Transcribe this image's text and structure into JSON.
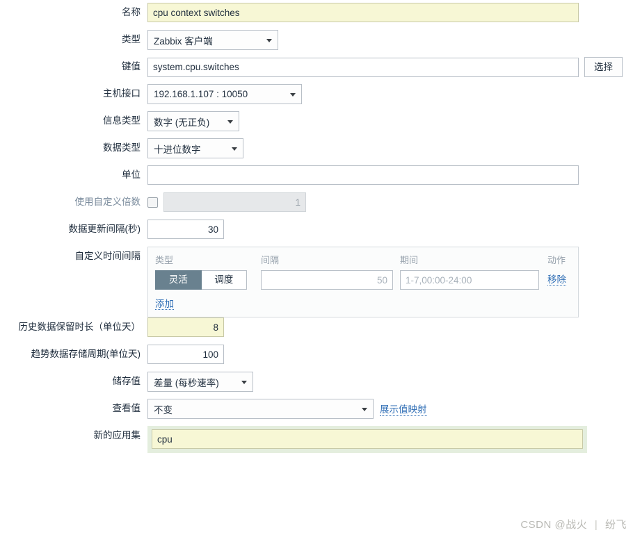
{
  "form": {
    "name": {
      "label": "名称",
      "value": "cpu context switches"
    },
    "type": {
      "label": "类型",
      "value": "Zabbix 客户端"
    },
    "key": {
      "label": "键值",
      "value": "system.cpu.switches",
      "select_button": "选择"
    },
    "host_interface": {
      "label": "主机接口",
      "value": "192.168.1.107 : 10050"
    },
    "info_type": {
      "label": "信息类型",
      "value": "数字 (无正负)"
    },
    "data_type": {
      "label": "数据类型",
      "value": "十进位数字"
    },
    "units": {
      "label": "单位",
      "value": ""
    },
    "custom_multiplier": {
      "label": "使用自定义倍数",
      "checked": false,
      "value": "1"
    },
    "update_interval": {
      "label": "数据更新间隔(秒)",
      "value": "30"
    },
    "custom_intervals": {
      "label": "自定义时间间隔",
      "headers": {
        "type": "类型",
        "interval": "间隔",
        "period": "期间",
        "action": "动作"
      },
      "rows": [
        {
          "type_options": [
            "灵活",
            "调度"
          ],
          "type_selected": "灵活",
          "interval_placeholder": "50",
          "interval_value": "",
          "period_placeholder": "1-7,00:00-24:00",
          "period_value": "",
          "action_label": "移除"
        }
      ],
      "add_label": "添加"
    },
    "history_storage": {
      "label": "历史数据保留时长（单位天）",
      "value": "8"
    },
    "trend_storage": {
      "label": "趋势数据存储周期(单位天)",
      "value": "100"
    },
    "store_value": {
      "label": "储存值",
      "value": "差量 (每秒速率)"
    },
    "show_value": {
      "label": "查看值",
      "value": "不变",
      "link_label": "展示值映射"
    },
    "new_application": {
      "label": "新的应用集",
      "value": "cpu"
    }
  },
  "watermark": {
    "prefix": "CSDN @战火",
    "separator": "|",
    "suffix": "纷飞"
  },
  "colors": {
    "highlight_yellow": "#f7f7d5",
    "link_blue": "#2f6eb5",
    "toggle_active": "#69818f",
    "app_wrapper_green": "#e4eede"
  }
}
